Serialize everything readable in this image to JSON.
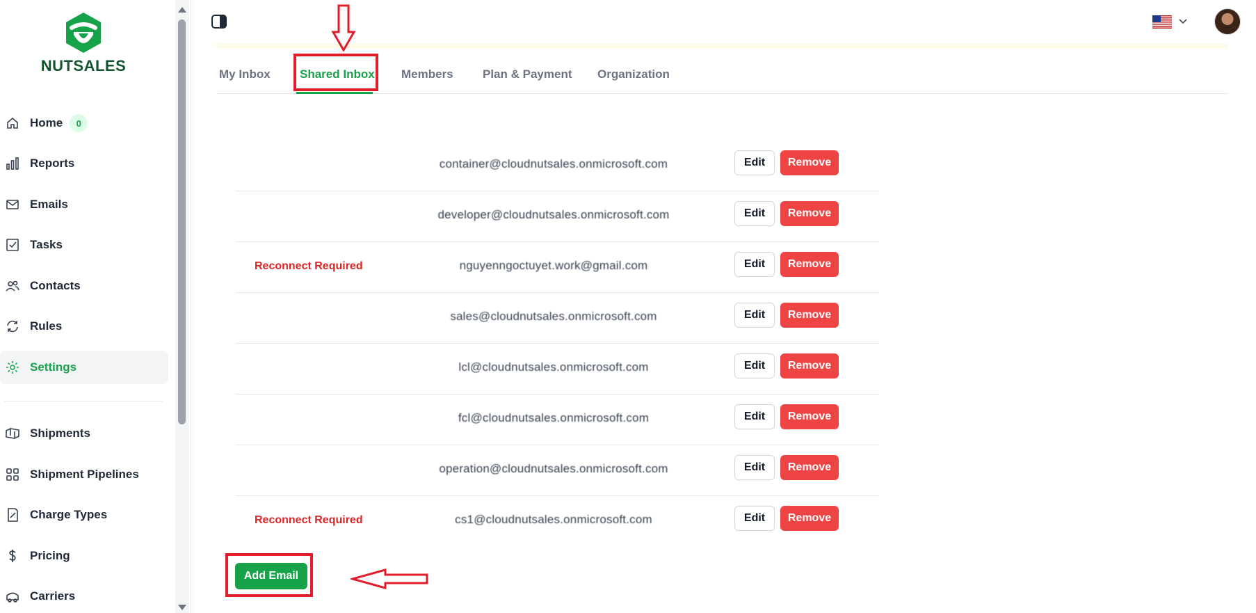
{
  "brand": {
    "name": "NUTSALES",
    "color": "#16a34a"
  },
  "sidebar": {
    "items": [
      {
        "label": "Home",
        "icon": "home-icon",
        "badge": "0"
      },
      {
        "label": "Reports",
        "icon": "bar-chart-icon"
      },
      {
        "label": "Emails",
        "icon": "mail-icon"
      },
      {
        "label": "Tasks",
        "icon": "checkbox-icon"
      },
      {
        "label": "Contacts",
        "icon": "users-icon"
      },
      {
        "label": "Rules",
        "icon": "refresh-icon"
      },
      {
        "label": "Settings",
        "icon": "gear-icon",
        "active": true
      },
      {
        "label": "Shipments",
        "icon": "package-icon"
      },
      {
        "label": "Shipment Pipelines",
        "icon": "grid-icon"
      },
      {
        "label": "Charge Types",
        "icon": "receipt-icon"
      },
      {
        "label": "Pricing",
        "icon": "dollar-icon"
      },
      {
        "label": "Carriers",
        "icon": "truck-icon"
      }
    ]
  },
  "header": {
    "flag": "us-flag-icon"
  },
  "tabs": [
    {
      "label": "My Inbox"
    },
    {
      "label": "Shared Inbox",
      "active": true
    },
    {
      "label": "Members"
    },
    {
      "label": "Plan & Payment"
    },
    {
      "label": "Organization"
    }
  ],
  "inboxes": [
    {
      "status": "",
      "email": "container@cloudnutsales.onmicrosoft.com"
    },
    {
      "status": "",
      "email": "developer@cloudnutsales.onmicrosoft.com"
    },
    {
      "status": "Reconnect Required",
      "email": "nguyenngoctuyet.work@gmail.com"
    },
    {
      "status": "",
      "email": "sales@cloudnutsales.onmicrosoft.com"
    },
    {
      "status": "",
      "email": "lcl@cloudnutsales.onmicrosoft.com"
    },
    {
      "status": "",
      "email": "fcl@cloudnutsales.onmicrosoft.com"
    },
    {
      "status": "",
      "email": "operation@cloudnutsales.onmicrosoft.com"
    },
    {
      "status": "Reconnect Required",
      "email": "cs1@cloudnutsales.onmicrosoft.com"
    }
  ],
  "actions": {
    "edit_label": "Edit",
    "remove_label": "Remove",
    "add_label": "Add Email"
  },
  "colors": {
    "accent": "#16a34a",
    "danger": "#ef4444",
    "annotation": "#e11d2a"
  }
}
